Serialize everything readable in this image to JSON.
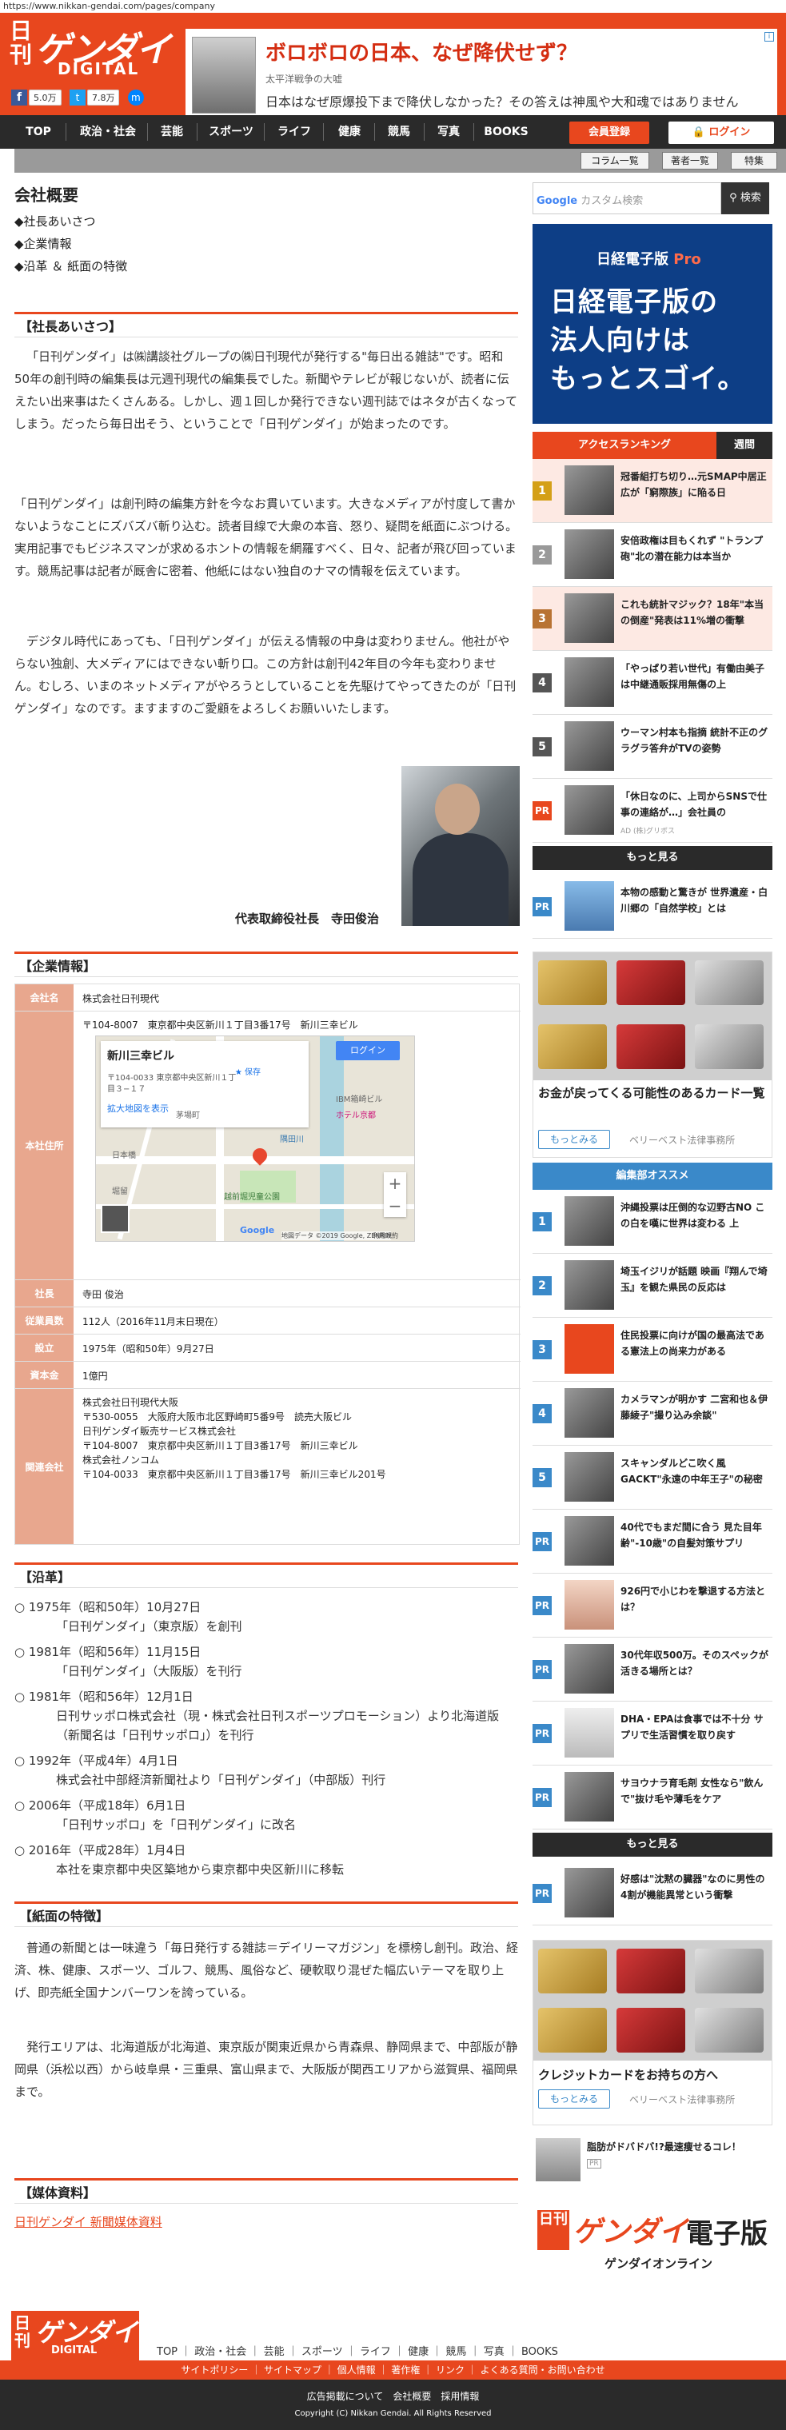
{
  "url": "https://www.nikkan-gendai.com/pages/company",
  "site": {
    "logo_nikkan": "日刊",
    "logo_gendai": "ゲンダイ",
    "logo_digital": "DIGITAL",
    "fb_count": "5.0万",
    "tw_count": "7.8万"
  },
  "top_ad": {
    "title": "ボロボロの日本、なぜ降伏せず？",
    "source": "太平洋戦争の大嘘",
    "desc": "日本はなぜ原爆投下まで降伏しなかった？その答えは神風や大和魂ではありません"
  },
  "nav": {
    "items": [
      "TOP",
      "政治・社会",
      "芸能",
      "スポーツ",
      "ライフ",
      "健康",
      "競馬",
      "写真",
      "BOOKS"
    ],
    "register": "会員登録",
    "login": "ログイン"
  },
  "subnav": {
    "items": [
      "コラム一覧",
      "著者一覧",
      "特集"
    ]
  },
  "main": {
    "title": "会社概要",
    "toc": [
      "◆社長あいさつ",
      "◆企業情報",
      "◆沿革 ＆ 紙面の特徴"
    ],
    "greeting": {
      "heading": "【社長あいさつ】",
      "p1": "「日刊ゲンダイ」は㈱講談社グループの㈱日刊現代が発行する\"毎日出る雑誌\"です。昭和50年の創刊時の編集長は元週刊現代の編集長でした。新聞やテレビが報じないが、読者に伝えたい出来事はたくさんある。しかし、週１回しか発行できない週刊誌ではネタが古くなってしまう。だったら毎日出そう、ということで「日刊ゲンダイ」が始まったのです。",
      "p2": "「日刊ゲンダイ」は創刊時の編集方針を今なお貫いています。大きなメディアが忖度して書かないようなことにズバズバ斬り込む。読者目線で大衆の本音、怒り、疑問を紙面にぶつける。実用記事でもビジネスマンが求めるホントの情報を網羅すべく、日々、記者が飛び回っています。競馬記事は記者が厩舎に密着、他紙にはない独自のナマの情報を伝えています。",
      "p3": "デジタル時代にあっても、「日刊ゲンダイ」が伝える情報の中身は変わりません。他社がやらない独創、大メディアにはできない斬り口。この方針は創刊42年目の今年も変わりません。むしろ、いまのネットメディアがやろうとしていることを先駆けてやってきたのが「日刊ゲンダイ」なのです。ますますのご愛顧をよろしくお願いいたします。",
      "signature": "代表取締役社長　寺田俊治"
    },
    "company": {
      "heading": "【企業情報】",
      "rows": [
        {
          "label": "会社名",
          "value": "株式会社日刊現代"
        },
        {
          "label": "本社住所",
          "value": "〒104-8007　東京都中央区新川１丁目3番17号　新川三幸ビル"
        },
        {
          "label": "社長",
          "value": "寺田 俊治"
        },
        {
          "label": "従業員数",
          "value": "112人（2016年11月末日現在）"
        },
        {
          "label": "設立",
          "value": "1975年（昭和50年）9月27日"
        },
        {
          "label": "資本金",
          "value": "1億円"
        },
        {
          "label": "関連会社",
          "lines": [
            "株式会社日刊現代大阪",
            "〒530-0055　大阪府大阪市北区野崎町5番9号　読売大阪ビル",
            "日刊ゲンダイ販売サービス株式会社",
            "〒104-8007　東京都中央区新川１丁目3番17号　新川三幸ビル",
            "株式会社ノンコム",
            "〒104-0033　東京都中央区新川１丁目3番17号　新川三幸ビル201号"
          ]
        }
      ],
      "map": {
        "place": "新川三幸ビル",
        "addr": "〒104-0033 東京都中央区新川１丁目３−１７",
        "save": "保存",
        "enlarge": "拡大地図を表示",
        "login": "ログイン",
        "labels": [
          "IBM箱崎ビル",
          "ホテル京都",
          "茅場町",
          "日本橋",
          "堀留",
          "隅田川",
          "越前堀児童公園",
          "Google",
          "地図データ ©2019 Google, ZENRIN",
          "利用規約"
        ]
      }
    },
    "history": {
      "heading": "【沿革】",
      "items": [
        {
          "year": "○ 1975年（昭和50年）10月27日",
          "event": "「日刊ゲンダイ」（東京版）を創刊"
        },
        {
          "year": "○ 1981年（昭和56年）11月15日",
          "event": "「日刊ゲンダイ」（大阪版）を刊行"
        },
        {
          "year": "○ 1981年（昭和56年）12月1日",
          "event": "日刊サッポロ株式会社（現・株式会社日刊スポーツプロモーション）より北海道版（新聞名は「日刊サッポロ」）を刊行"
        },
        {
          "year": "○ 1992年（平成4年）4月1日",
          "event": "株式会社中部経済新聞社より「日刊ゲンダイ」（中部版）刊行"
        },
        {
          "year": "○ 2006年（平成18年）6月1日",
          "event": "「日刊サッポロ」を「日刊ゲンダイ」に改名"
        },
        {
          "year": "○ 2016年（平成28年）1月4日",
          "event": "本社を東京都中央区築地から東京都中央区新川に移転"
        }
      ]
    },
    "features": {
      "heading": "【紙面の特徴】",
      "p1": "普通の新聞とは一味違う「毎日発行する雑誌＝デイリーマガジン」を標榜し創刊。政治、経済、株、健康、スポーツ、ゴルフ、競馬、風俗など、硬軟取り混ぜた幅広いテーマを取り上げ、即売紙全国ナンバーワンを誇っている。",
      "p2": "発行エリアは、北海道版が北海道、東京版が関東近県から青森県、静岡県まで、中部版が静岡県（浜松以西）から岐阜県・三重県、富山県まで、大阪版が関西エリアから滋賀県、福岡県まで。"
    },
    "media": {
      "heading": "【媒体資料】",
      "link": "日刊ゲンダイ 新聞媒体資料"
    }
  },
  "sidebar": {
    "search_placeholder": "カスタム検索",
    "search_btn": "検索",
    "nikkei_ad": {
      "l1a": "日経電子版",
      "l1b": "Pro",
      "big": [
        "日経電子版の",
        "法人向けは",
        "もっとスゴイ。"
      ]
    },
    "ranking": {
      "tab": "アクセスランキング",
      "week": "週間",
      "items": [
        {
          "num": "1",
          "text": "冠番組打ち切り…元SMAP中居正広が「窮際族」に陥る日"
        },
        {
          "num": "2",
          "text": "安倍政権は目もくれず \"トランプ砲\"北の潜在能力は本当か"
        },
        {
          "num": "3",
          "text": "これも統計マジック？18年\"本当の倒産\"発表は11%増の衝撃"
        },
        {
          "num": "4",
          "text": "「やっぱり若い世代」有働由美子は中継通販採用無傷の上"
        },
        {
          "num": "5",
          "text": "ウーマン村本も指摘 統計不正のグラグラ答弁がTVの姿勢"
        },
        {
          "num": "PR",
          "text": "「休日なのに、上司からSNSで仕事の連絡が…」会社員の",
          "sub": "AD (株)グリボス"
        }
      ],
      "more": "もっと見る",
      "pr": {
        "num": "PR",
        "text": "本物の感動と驚きが 世界遺産・白川郷の「自然学校」とは"
      }
    },
    "card_ad1": {
      "title": "お金が戻ってくる可能性のあるカード一覧",
      "btn": "もっとみる",
      "sponsor": "ベリーベスト法律事務所"
    },
    "editor": {
      "heading": "編集部オススメ",
      "items": [
        {
          "num": "1",
          "text": "沖縄投票は圧倒的な辺野古NO この白を嘆に世界は変わる 上"
        },
        {
          "num": "2",
          "text": "埼玉イジリが話題 映画『翔んで埼玉』を観た県民の反応は"
        },
        {
          "num": "3",
          "text": "住民投票に向けが国の最高法である憲法上の尚来力がある"
        },
        {
          "num": "4",
          "text": "カメラマンが明かす 二宮和也＆伊藤綾子\"撮り込み余談\""
        },
        {
          "num": "5",
          "text": "スキャンダルどこ吹く風 GACKT\"永遠の中年王子\"の秘密"
        },
        {
          "num": "PR",
          "text": "40代でもまだ間に合う 見た目年齢\"-10歳\"の自髪対策サプリ"
        },
        {
          "num": "PR",
          "text": "926円で小じわを撃退する方法とは？"
        },
        {
          "num": "PR",
          "text": "30代年収500万。そのスペックが活きる場所とは？"
        },
        {
          "num": "PR",
          "text": "DHA・EPAは食事では不十分 サプリで生活習慣を取り戻す"
        },
        {
          "num": "PR",
          "text": "サヨウナラ育毛剤 女性なら\"飲んで\"抜け毛や薄毛をケア"
        }
      ],
      "more": "もっと見る",
      "pr": {
        "num": "PR",
        "text": "好感は\"沈黙の臓器\"なのに男性の4割が機能異常という衝撃"
      }
    },
    "card_ad2": {
      "title": "クレジットカードをお持ちの方へ",
      "btn": "もっとみる",
      "sponsor": "ベリーベスト法律事務所"
    },
    "small_ad": "脂肪がドバドバ!?最速痩せるコレ！",
    "small_ad_pr": "PR",
    "bottom_logo": {
      "nikkan": "日刊",
      "gendai": "ゲンダイ",
      "denshi": "電子版",
      "online": "ゲンダイオンライン"
    }
  },
  "footer": {
    "nav": [
      "TOP",
      "政治・社会",
      "芸能",
      "スポーツ",
      "ライフ",
      "健康",
      "競馬",
      "写真",
      "BOOKS"
    ],
    "bar": "サイトポリシー ｜ サイトマップ ｜ 個人情報 ｜ 著作権 ｜ リンク ｜ よくある質問・お問い合わせ",
    "links": "広告掲載について　会社概要　採用情報",
    "copyright": "Copyright (C) Nikkan Gendai. All Rights Reserved"
  }
}
